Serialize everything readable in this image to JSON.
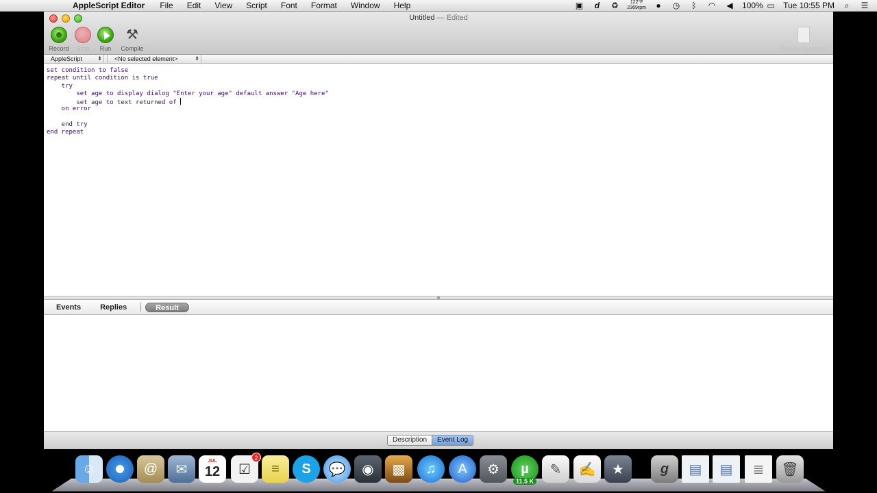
{
  "menubar": {
    "app_name": "AppleScript Editor",
    "menus": [
      "File",
      "Edit",
      "View",
      "Script",
      "Font",
      "Format",
      "Window",
      "Help"
    ],
    "temp_line1": "122°F",
    "temp_line2": "2369rpm",
    "battery": "100%",
    "clock": "Tue 10:55 PM",
    "icons": [
      "camera-icon",
      "d-icon",
      "activity-icon",
      "ubuntu-icon",
      "time-machine-icon",
      "bluetooth-icon",
      "wifi-icon",
      "volume-icon",
      "battery-icon",
      "spotlight-icon",
      "list-icon"
    ]
  },
  "window": {
    "title": "Untitled",
    "title_sep": " — ",
    "title_state": "Edited"
  },
  "toolbar": {
    "record": "Record",
    "stop": "Stop",
    "run": "Run",
    "compile": "Compile",
    "bundle": "Bundle Contents"
  },
  "navbar": {
    "language": "AppleScript",
    "element": "<No selected element>"
  },
  "editor": {
    "lines": [
      "set condition to false",
      "repeat until condition is true",
      "    try",
      "        set age to display dialog \"Enter your age\" default answer \"Age here\"",
      "        set age to text returned of ",
      "    on error",
      "",
      "    end try",
      "end repeat"
    ]
  },
  "result_tabs": {
    "events": "Events",
    "replies": "Replies",
    "result": "Result"
  },
  "bottom": {
    "description": "Description",
    "event_log": "Event Log"
  },
  "dock": {
    "calendar_month": "JUL",
    "calendar_day": "12",
    "reminders_badge": "2",
    "utorrent_speed": "11.5 K"
  }
}
